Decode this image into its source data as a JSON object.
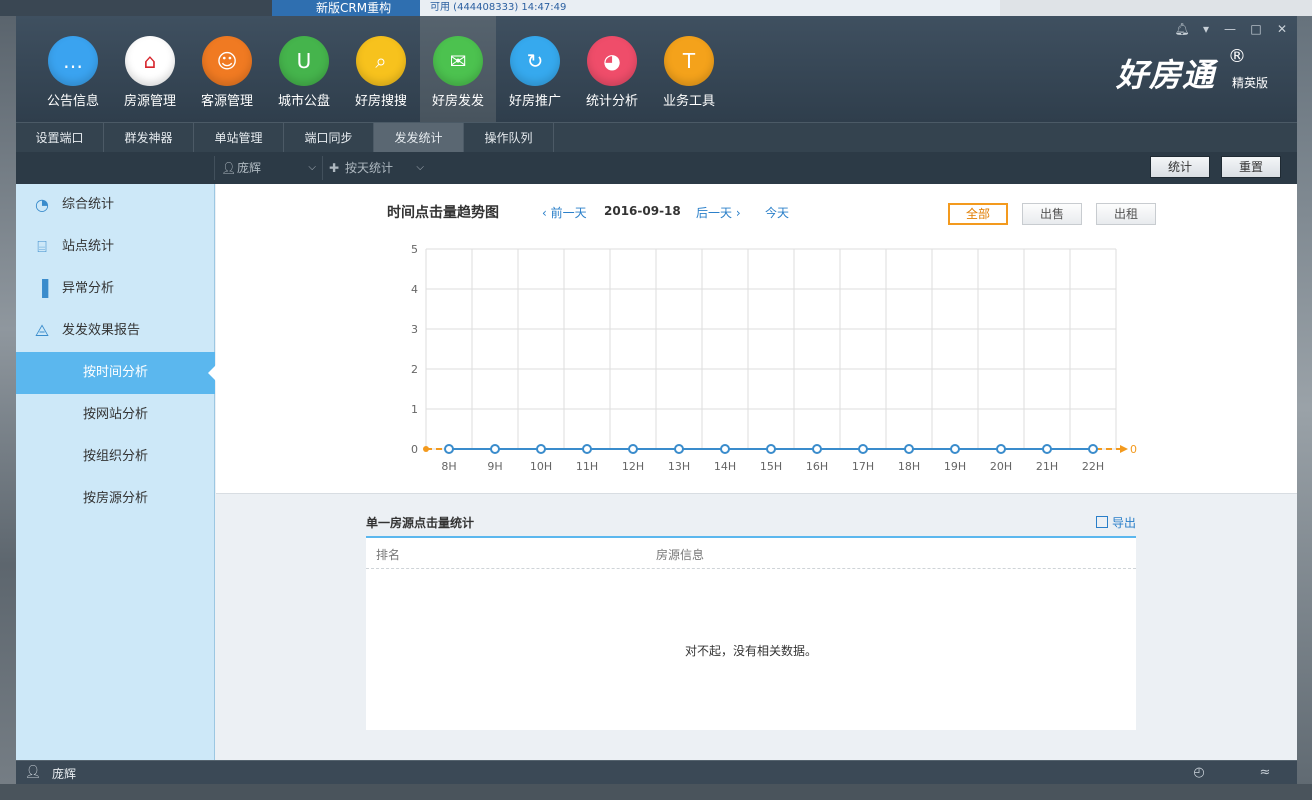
{
  "desktop": {
    "taskbar_text": "新版CRM重构",
    "strip_text": "可用 (444408333) 14:47:49",
    "colors": {
      "accent": "#2a7fc9",
      "orange": "#f39a1e"
    }
  },
  "window": {
    "controls": [
      "bell-icon",
      "dropdown-icon",
      "minimize-icon",
      "maximize-icon",
      "close-icon"
    ],
    "brand": {
      "name": "好房通",
      "reg": "®",
      "edition": "精英版"
    }
  },
  "nav": {
    "items": [
      {
        "label": "公告信息",
        "icon": "chat-bubble-icon",
        "color": "#3aa3f0"
      },
      {
        "label": "房源管理",
        "icon": "house-icon",
        "color": "#ffffff"
      },
      {
        "label": "客源管理",
        "icon": "user-icon",
        "color": "#f07a22"
      },
      {
        "label": "城市公盘",
        "icon": "shield-icon",
        "color": "#45b44c"
      },
      {
        "label": "好房搜搜",
        "icon": "search-icon",
        "color": "#f7c21d"
      },
      {
        "label": "好房发发",
        "icon": "envelope-icon",
        "color": "#4cc24f"
      },
      {
        "label": "好房推广",
        "icon": "promote-icon",
        "color": "#36a9ee"
      },
      {
        "label": "统计分析",
        "icon": "pie-chart-icon",
        "color": "#ef4d6a"
      },
      {
        "label": "业务工具",
        "icon": "hammer-icon",
        "color": "#f4a21b"
      }
    ]
  },
  "subnav": {
    "items": [
      "设置端口",
      "群发神器",
      "单站管理",
      "端口同步",
      "发发统计",
      "操作队列"
    ]
  },
  "filter": {
    "user": "庞辉",
    "mode": "按天统计",
    "stat_label": "统计",
    "reset_label": "重置"
  },
  "sidebar": {
    "items": [
      {
        "label": "综合统计",
        "icon": "pie-icon"
      },
      {
        "label": "站点统计",
        "icon": "monitor-chart-icon"
      },
      {
        "label": "异常分析",
        "icon": "bar-icon"
      },
      {
        "label": "发发效果报告",
        "icon": "line-icon"
      }
    ],
    "subitems": [
      "按时间分析",
      "按网站分析",
      "按组织分析",
      "按房源分析"
    ]
  },
  "chart_header": {
    "title": "时间点击量趋势图",
    "prev": "前一天",
    "date": "2016-09-18",
    "next": "后一天",
    "today": "今天",
    "filters": [
      "全部",
      "出售",
      "出租"
    ]
  },
  "chart_data": {
    "type": "line",
    "x": [
      "8H",
      "9H",
      "10H",
      "11H",
      "12H",
      "13H",
      "14H",
      "15H",
      "16H",
      "17H",
      "18H",
      "19H",
      "20H",
      "21H",
      "22H"
    ],
    "series": [
      {
        "values": [
          0,
          0,
          0,
          0,
          0,
          0,
          0,
          0,
          0,
          0,
          0,
          0,
          0,
          0,
          0
        ],
        "color": "#3a8ccc"
      },
      {
        "values": [
          0,
          0,
          0,
          0,
          0,
          0,
          0,
          0,
          0,
          0,
          0,
          0,
          0,
          0,
          0
        ],
        "color": "#f39a1e"
      }
    ],
    "ylim": [
      0,
      5
    ],
    "yticks": [
      "0",
      "1",
      "2",
      "3",
      "4",
      "5"
    ],
    "end_label": "0",
    "grid": true
  },
  "table": {
    "title": "单一房源点击量统计",
    "export_label": "导出",
    "columns": [
      "排名",
      "房源信息"
    ],
    "empty_text": "对不起，没有相关数据。"
  },
  "status": {
    "user": "庞辉"
  }
}
